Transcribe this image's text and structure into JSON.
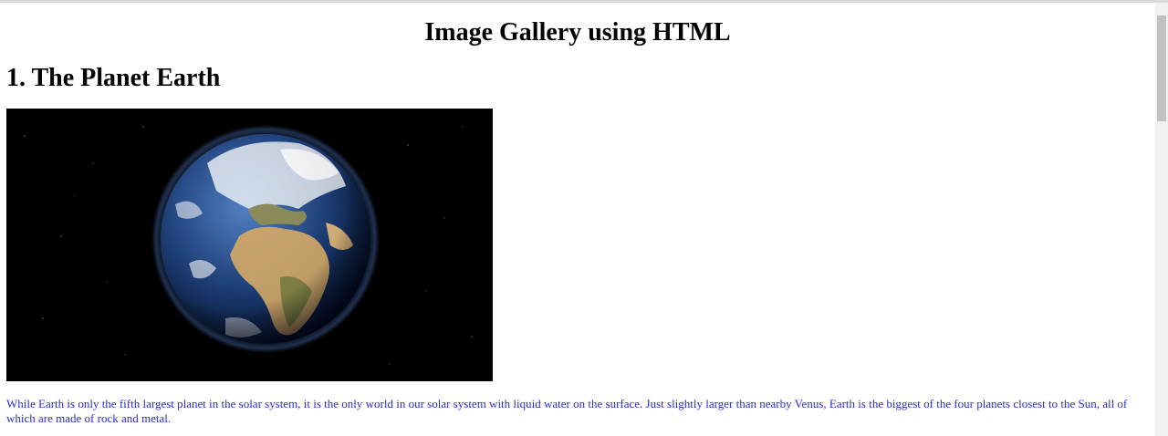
{
  "page": {
    "title": "Image Gallery using HTML"
  },
  "gallery": {
    "sections": [
      {
        "heading": "1. The Planet Earth",
        "image": {
          "subject": "planet-earth-icon"
        },
        "description": "While Earth is only the fifth largest planet in the solar system, it is the only world in our solar system with liquid water on the surface. Just slightly larger than nearby Venus, Earth is the biggest of the four planets closest to the Sun, all of which are made of rock and metal."
      }
    ]
  },
  "colors": {
    "description_text": "#2b2bd6",
    "page_background": "#ffffff",
    "image_background": "#000000"
  }
}
